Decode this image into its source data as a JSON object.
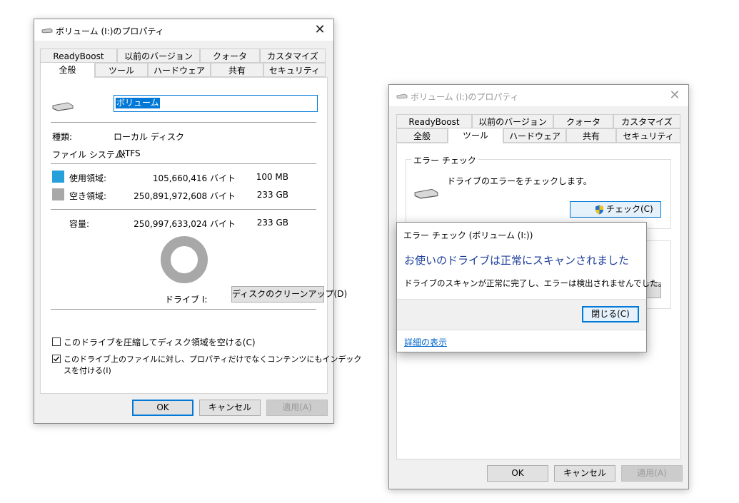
{
  "win1": {
    "title": "ボリューム (I:)のプロパティ",
    "tabs_row1": [
      "ReadyBoost",
      "以前のバージョン",
      "クォータ",
      "カスタマイズ"
    ],
    "tabs_row2": [
      "全般",
      "ツール",
      "ハードウェア",
      "共有",
      "セキュリティ"
    ],
    "active_tab": "全般",
    "volume_name": "ボリューム",
    "type_label": "種類:",
    "type_value": "ローカル ディスク",
    "fs_label": "ファイル システム:",
    "fs_value": "NTFS",
    "used_label": "使用領域:",
    "used_bytes": "105,660,416 バイト",
    "used_size": "100 MB",
    "free_label": "空き領域:",
    "free_bytes": "250,891,972,608 バイト",
    "free_size": "233 GB",
    "capacity_label": "容量:",
    "capacity_bytes": "250,997,633,024 バイト",
    "capacity_size": "233 GB",
    "used_fraction": 0.0004,
    "drive_label": "ドライブ I:",
    "cleanup_button": "ディスクのクリーンアップ(D)",
    "compress_label": "このドライブを圧縮してディスク領域を空ける(C)",
    "compress_checked": false,
    "index_label_line1": "このドライブ上のファイルに対し、プロパティだけでなくコンテンツにもインデック",
    "index_label_line2": "スを付ける(I)",
    "index_checked": true,
    "ok": "OK",
    "cancel": "キャンセル",
    "apply": "適用(A)",
    "colors": {
      "used": "#26a0da",
      "free": "#a8a8a8"
    }
  },
  "win2": {
    "title": "ボリューム (I:)のプロパティ",
    "tabs_row1": [
      "ReadyBoost",
      "以前のバージョン",
      "クォータ",
      "カスタマイズ"
    ],
    "tabs_row2": [
      "全般",
      "ツール",
      "ハードウェア",
      "共有",
      "セキュリティ"
    ],
    "active_tab": "ツール",
    "error_check_group": "エラー チェック",
    "error_check_desc": "ドライブのエラーをチェックします。",
    "check_button": "チェック(C)",
    "ok": "OK",
    "cancel": "キャンセル",
    "apply": "適用(A)"
  },
  "dialog": {
    "title": "エラー チェック (ボリューム (I:))",
    "heading": "お使いのドライブは正常にスキャンされました",
    "message": "ドライブのスキャンが正常に完了し、エラーは検出されませんでした。",
    "close_button": "閉じる(C)",
    "details_link": "詳細の表示"
  }
}
